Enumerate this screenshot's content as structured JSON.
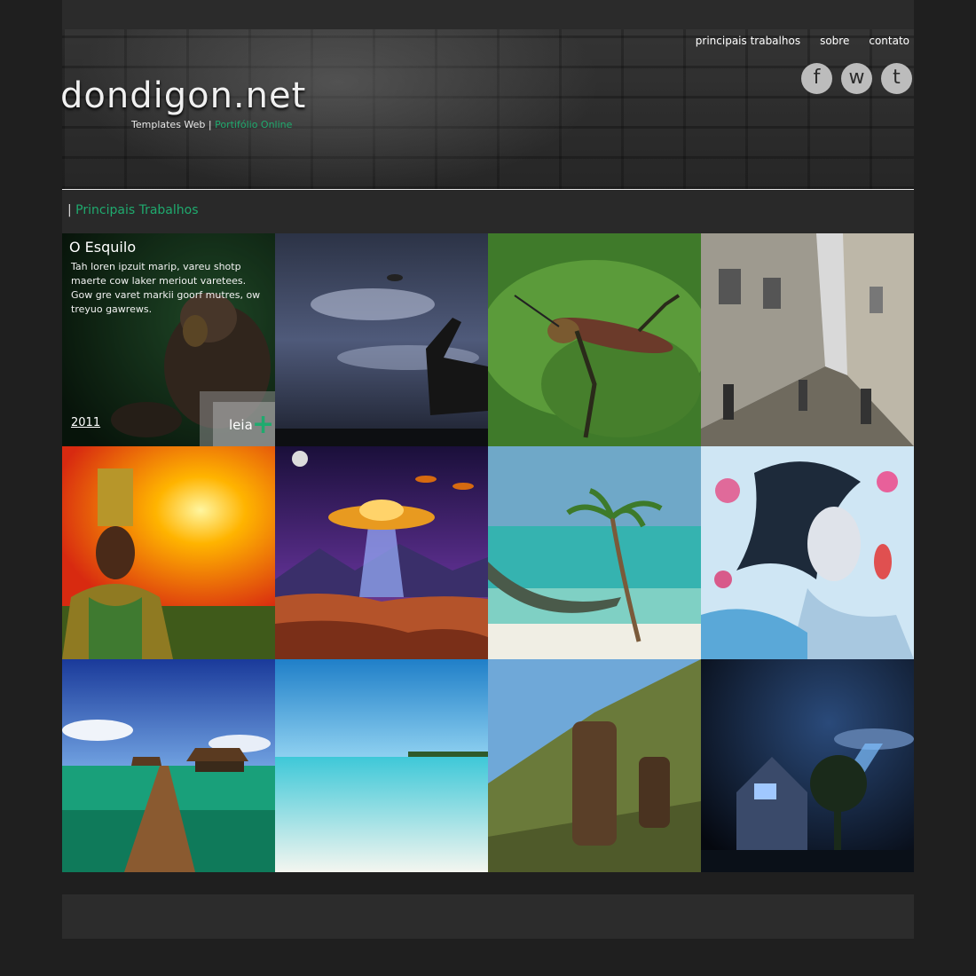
{
  "site": {
    "logo": "dondigon.net",
    "tagline_left": "Templates Web",
    "tagline_sep": "|",
    "tagline_right": "Portifólio Online"
  },
  "nav": {
    "items": [
      {
        "label": "principais trabalhos"
      },
      {
        "label": "sobre"
      },
      {
        "label": "contato"
      }
    ]
  },
  "social": [
    {
      "label": "f",
      "icon": "facebook-icon"
    },
    {
      "label": "w",
      "icon": "wordpress-icon"
    },
    {
      "label": "t",
      "icon": "twitter-icon"
    }
  ],
  "section": {
    "pipe": "|",
    "title": "Principais Trabalhos"
  },
  "featured": {
    "title": "O Esquilo",
    "description": "Tah loren ipzuit marip, vareu shotp maerte cow laker meriout varetees. Gow gre varet markii goorf mutres, ow treyuo gawrews.",
    "year": "2011",
    "more_label": "leia",
    "more_icon": "plus-icon"
  },
  "colors": {
    "accent": "#1faa6e",
    "background": "#1f1f1f",
    "panel": "#2b2b2b"
  }
}
